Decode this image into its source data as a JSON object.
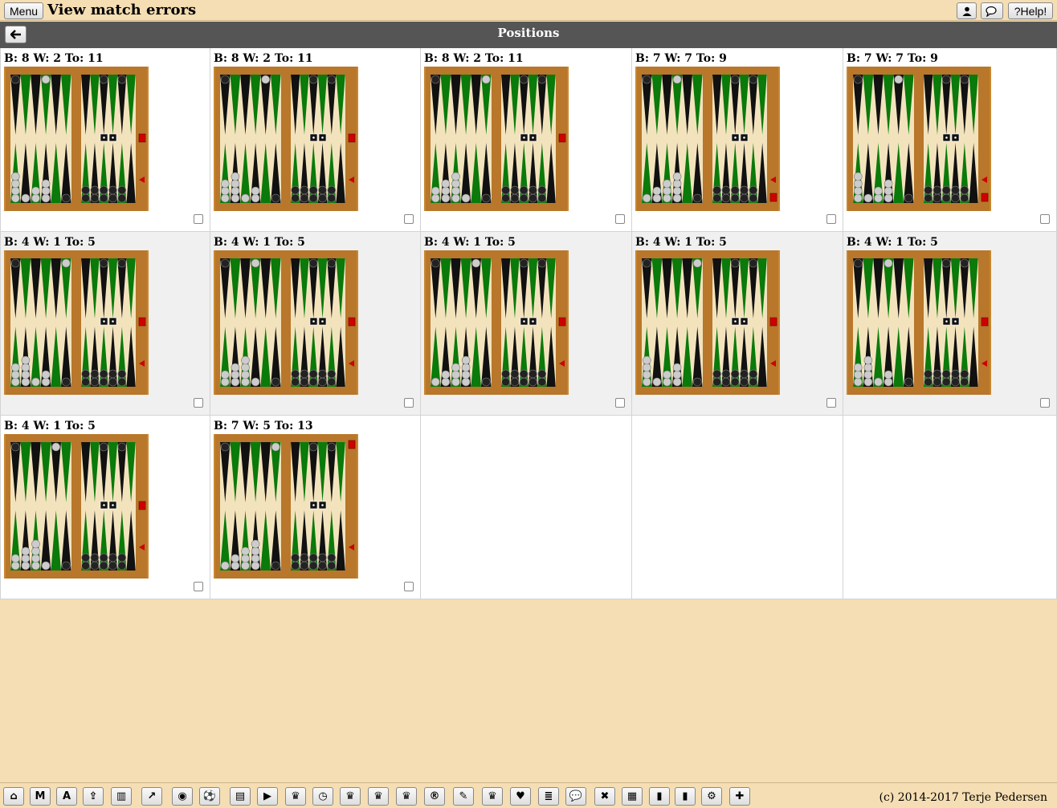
{
  "topbar": {
    "menu_label": "Menu",
    "title": "View match errors",
    "help_label": "?Help!"
  },
  "subhead": {
    "title": "Positions"
  },
  "positions": [
    {
      "label": "B: 8 W: 2 To: 11",
      "cube": "right",
      "arrow": true
    },
    {
      "label": "B: 8 W: 2 To: 11",
      "cube": "right",
      "arrow": true
    },
    {
      "label": "B: 8 W: 2 To: 11",
      "cube": "right",
      "arrow": false
    },
    {
      "label": "B: 7 W: 7 To: 9",
      "cube": "bottom",
      "arrow": true
    },
    {
      "label": "B: 7 W: 7 To: 9",
      "cube": "bottom",
      "arrow": true
    },
    {
      "label": "B: 4 W: 1 To: 5",
      "cube": "right",
      "arrow": true
    },
    {
      "label": "B: 4 W: 1 To: 5",
      "cube": "right",
      "arrow": true
    },
    {
      "label": "B: 4 W: 1 To: 5",
      "cube": "right",
      "arrow": true
    },
    {
      "label": "B: 4 W: 1 To: 5",
      "cube": "right",
      "arrow": true
    },
    {
      "label": "B: 4 W: 1 To: 5",
      "cube": "right",
      "arrow": true
    },
    {
      "label": "B: 4 W: 1 To: 5",
      "cube": "right",
      "arrow": true
    },
    {
      "label": "B: 7 W: 5 To: 13",
      "cube": "top",
      "arrow": true
    }
  ],
  "toolbar": [
    {
      "name": "home-icon",
      "glyph": "⌂"
    },
    {
      "name": "m-button",
      "glyph": "M"
    },
    {
      "name": "a-button",
      "glyph": "A"
    },
    {
      "name": "upload-icon",
      "glyph": "⇪"
    },
    {
      "name": "bar-chart-icon",
      "glyph": "▥"
    },
    {
      "name": "line-chart-icon",
      "glyph": "↗"
    },
    {
      "name": "eye-icon",
      "glyph": "◉"
    },
    {
      "name": "soccer-ball-icon",
      "glyph": "⚽"
    },
    {
      "name": "archive-icon",
      "glyph": "▤"
    },
    {
      "name": "play-icon",
      "glyph": "▶"
    },
    {
      "name": "trophy-icon",
      "glyph": "♛"
    },
    {
      "name": "clock-icon",
      "glyph": "◷"
    },
    {
      "name": "trophy-icon",
      "glyph": "♛"
    },
    {
      "name": "trophy-icon",
      "glyph": "♛"
    },
    {
      "name": "trophy-icon",
      "glyph": "♛"
    },
    {
      "name": "registered-icon",
      "glyph": "®"
    },
    {
      "name": "edit-icon",
      "glyph": "✎"
    },
    {
      "name": "trophy-icon",
      "glyph": "♛"
    },
    {
      "name": "heart-icon",
      "glyph": "♥"
    },
    {
      "name": "database-icon",
      "glyph": "≣"
    },
    {
      "name": "chat-icon",
      "glyph": "💬"
    },
    {
      "name": "close-icon",
      "glyph": "✖"
    },
    {
      "name": "film-icon",
      "glyph": "▦"
    },
    {
      "name": "bookmark-icon",
      "glyph": "▮"
    },
    {
      "name": "bookmark-icon",
      "glyph": "▮"
    },
    {
      "name": "settings-icon",
      "glyph": "⚙"
    },
    {
      "name": "plus-icon",
      "glyph": "✚"
    }
  ],
  "footer": {
    "copyright": "(c) 2014-2017 Terje Pedersen"
  }
}
